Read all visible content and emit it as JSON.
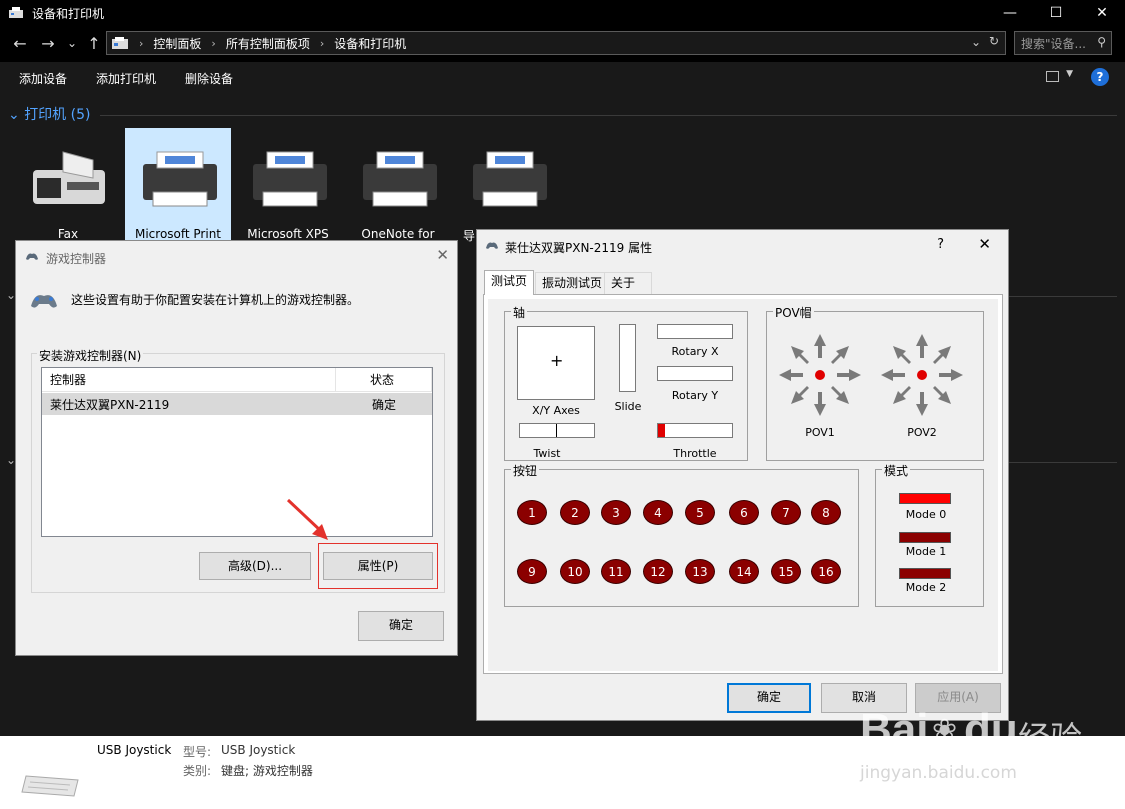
{
  "window": {
    "title": "设备和打印机",
    "controls": [
      "—",
      "☐",
      "✕"
    ]
  },
  "address": {
    "crumbs": [
      "控制面板",
      "所有控制面板项",
      "设备和打印机"
    ],
    "search_placeholder": "搜索\"设备...",
    "expand": "⌄",
    "refresh": "↻"
  },
  "nav": {
    "back": "←",
    "forward": "→",
    "recent": "⌄",
    "up": "↑"
  },
  "toolbar": {
    "add_device": "添加设备",
    "add_printer": "添加打印机",
    "remove_device": "删除设备",
    "help": "?",
    "view_drop": "▼"
  },
  "group": {
    "header": "打印机 (5)"
  },
  "devices": [
    "Fax",
    "Microsoft Print",
    "Microsoft XPS",
    "OneNote for",
    "导出为WPS PDF"
  ],
  "status": {
    "device_name": "USB  Joystick",
    "model_key": "型号:",
    "model_val": "USB  Joystick",
    "category_key": "类别:",
    "category_val": "键盘; 游戏控制器"
  },
  "game_ctrl": {
    "title": "游戏控制器",
    "close": "✕",
    "intro": "这些设置有助于你配置安装在计算机上的游戏控制器。",
    "group_label": "安装游戏控制器(N)",
    "col_controller": "控制器",
    "col_status": "状态",
    "row_name": "莱仕达双翼PXN-2119",
    "row_status": "确定",
    "advanced": "高级(D)...",
    "properties": "属性(P)",
    "ok": "确定"
  },
  "props": {
    "title": "莱仕达双翼PXN-2119 属性",
    "help": "?",
    "close": "✕",
    "tabs": [
      "测试页",
      "振动测试页",
      "关于"
    ],
    "axis_group": "轴",
    "xy_label": "X/Y Axes",
    "slide_label": "Slide",
    "rotx_label": "Rotary X",
    "roty_label": "Rotary Y",
    "twist_label": "Twist",
    "throttle_label": "Throttle",
    "throttle_level": 0.1,
    "pov_group": "POV帽",
    "pov1": "POV1",
    "pov2": "POV2",
    "buttons_group": "按钮",
    "buttons_row1": [
      "1",
      "2",
      "3",
      "4",
      "5",
      "6",
      "7",
      "8"
    ],
    "buttons_row2": [
      "9",
      "10",
      "11",
      "12",
      "13",
      "14",
      "15",
      "16"
    ],
    "mode_group": "模式",
    "modes": [
      "Mode 0",
      "Mode 1",
      "Mode 2"
    ],
    "ok": "确定",
    "cancel": "取消",
    "apply": "应用(A)"
  },
  "watermark": {
    "brand": "Bai",
    "du": "du",
    "jy": "经验",
    "url": "jingyan.baidu.com"
  },
  "colors": {
    "accent": "#53a3ff",
    "selected": "#cce8ff",
    "button_red": "#8b0000",
    "mode_active": "#ff0000",
    "highlight": "#e3322c"
  }
}
